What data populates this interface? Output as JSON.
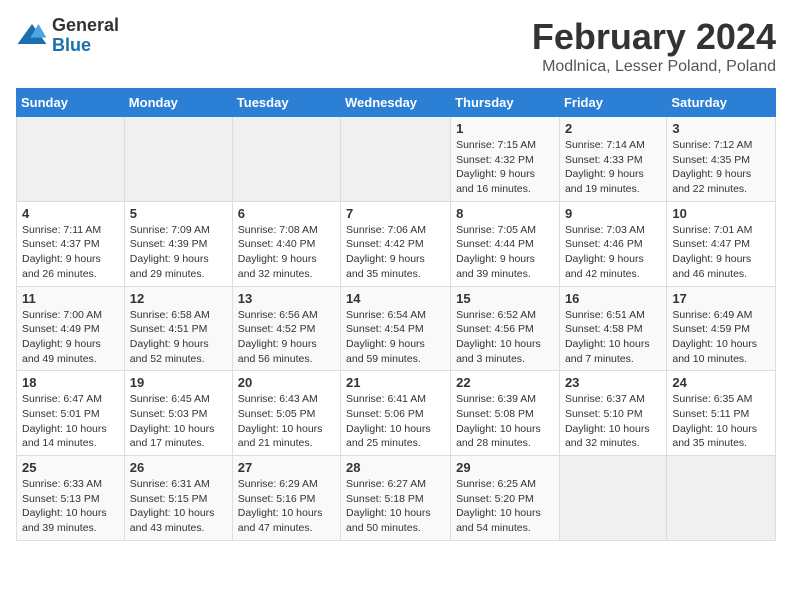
{
  "header": {
    "logo_line1": "General",
    "logo_line2": "Blue",
    "title": "February 2024",
    "subtitle": "Modlnica, Lesser Poland, Poland"
  },
  "days_of_week": [
    "Sunday",
    "Monday",
    "Tuesday",
    "Wednesday",
    "Thursday",
    "Friday",
    "Saturday"
  ],
  "weeks": [
    [
      {
        "day": "",
        "sunrise": "",
        "sunset": "",
        "daylight": "",
        "empty": true
      },
      {
        "day": "",
        "sunrise": "",
        "sunset": "",
        "daylight": "",
        "empty": true
      },
      {
        "day": "",
        "sunrise": "",
        "sunset": "",
        "daylight": "",
        "empty": true
      },
      {
        "day": "",
        "sunrise": "",
        "sunset": "",
        "daylight": "",
        "empty": true
      },
      {
        "day": "1",
        "sunrise": "7:15 AM",
        "sunset": "4:32 PM",
        "daylight": "9 hours and 16 minutes."
      },
      {
        "day": "2",
        "sunrise": "7:14 AM",
        "sunset": "4:33 PM",
        "daylight": "9 hours and 19 minutes."
      },
      {
        "day": "3",
        "sunrise": "7:12 AM",
        "sunset": "4:35 PM",
        "daylight": "9 hours and 22 minutes."
      }
    ],
    [
      {
        "day": "4",
        "sunrise": "7:11 AM",
        "sunset": "4:37 PM",
        "daylight": "9 hours and 26 minutes."
      },
      {
        "day": "5",
        "sunrise": "7:09 AM",
        "sunset": "4:39 PM",
        "daylight": "9 hours and 29 minutes."
      },
      {
        "day": "6",
        "sunrise": "7:08 AM",
        "sunset": "4:40 PM",
        "daylight": "9 hours and 32 minutes."
      },
      {
        "day": "7",
        "sunrise": "7:06 AM",
        "sunset": "4:42 PM",
        "daylight": "9 hours and 35 minutes."
      },
      {
        "day": "8",
        "sunrise": "7:05 AM",
        "sunset": "4:44 PM",
        "daylight": "9 hours and 39 minutes."
      },
      {
        "day": "9",
        "sunrise": "7:03 AM",
        "sunset": "4:46 PM",
        "daylight": "9 hours and 42 minutes."
      },
      {
        "day": "10",
        "sunrise": "7:01 AM",
        "sunset": "4:47 PM",
        "daylight": "9 hours and 46 minutes."
      }
    ],
    [
      {
        "day": "11",
        "sunrise": "7:00 AM",
        "sunset": "4:49 PM",
        "daylight": "9 hours and 49 minutes."
      },
      {
        "day": "12",
        "sunrise": "6:58 AM",
        "sunset": "4:51 PM",
        "daylight": "9 hours and 52 minutes."
      },
      {
        "day": "13",
        "sunrise": "6:56 AM",
        "sunset": "4:52 PM",
        "daylight": "9 hours and 56 minutes."
      },
      {
        "day": "14",
        "sunrise": "6:54 AM",
        "sunset": "4:54 PM",
        "daylight": "9 hours and 59 minutes."
      },
      {
        "day": "15",
        "sunrise": "6:52 AM",
        "sunset": "4:56 PM",
        "daylight": "10 hours and 3 minutes."
      },
      {
        "day": "16",
        "sunrise": "6:51 AM",
        "sunset": "4:58 PM",
        "daylight": "10 hours and 7 minutes."
      },
      {
        "day": "17",
        "sunrise": "6:49 AM",
        "sunset": "4:59 PM",
        "daylight": "10 hours and 10 minutes."
      }
    ],
    [
      {
        "day": "18",
        "sunrise": "6:47 AM",
        "sunset": "5:01 PM",
        "daylight": "10 hours and 14 minutes."
      },
      {
        "day": "19",
        "sunrise": "6:45 AM",
        "sunset": "5:03 PM",
        "daylight": "10 hours and 17 minutes."
      },
      {
        "day": "20",
        "sunrise": "6:43 AM",
        "sunset": "5:05 PM",
        "daylight": "10 hours and 21 minutes."
      },
      {
        "day": "21",
        "sunrise": "6:41 AM",
        "sunset": "5:06 PM",
        "daylight": "10 hours and 25 minutes."
      },
      {
        "day": "22",
        "sunrise": "6:39 AM",
        "sunset": "5:08 PM",
        "daylight": "10 hours and 28 minutes."
      },
      {
        "day": "23",
        "sunrise": "6:37 AM",
        "sunset": "5:10 PM",
        "daylight": "10 hours and 32 minutes."
      },
      {
        "day": "24",
        "sunrise": "6:35 AM",
        "sunset": "5:11 PM",
        "daylight": "10 hours and 35 minutes."
      }
    ],
    [
      {
        "day": "25",
        "sunrise": "6:33 AM",
        "sunset": "5:13 PM",
        "daylight": "10 hours and 39 minutes."
      },
      {
        "day": "26",
        "sunrise": "6:31 AM",
        "sunset": "5:15 PM",
        "daylight": "10 hours and 43 minutes."
      },
      {
        "day": "27",
        "sunrise": "6:29 AM",
        "sunset": "5:16 PM",
        "daylight": "10 hours and 47 minutes."
      },
      {
        "day": "28",
        "sunrise": "6:27 AM",
        "sunset": "5:18 PM",
        "daylight": "10 hours and 50 minutes."
      },
      {
        "day": "29",
        "sunrise": "6:25 AM",
        "sunset": "5:20 PM",
        "daylight": "10 hours and 54 minutes."
      },
      {
        "day": "",
        "sunrise": "",
        "sunset": "",
        "daylight": "",
        "empty": true
      },
      {
        "day": "",
        "sunrise": "",
        "sunset": "",
        "daylight": "",
        "empty": true
      }
    ]
  ],
  "labels": {
    "sunrise_prefix": "Sunrise: ",
    "sunset_prefix": "Sunset: ",
    "daylight_prefix": "Daylight: "
  }
}
